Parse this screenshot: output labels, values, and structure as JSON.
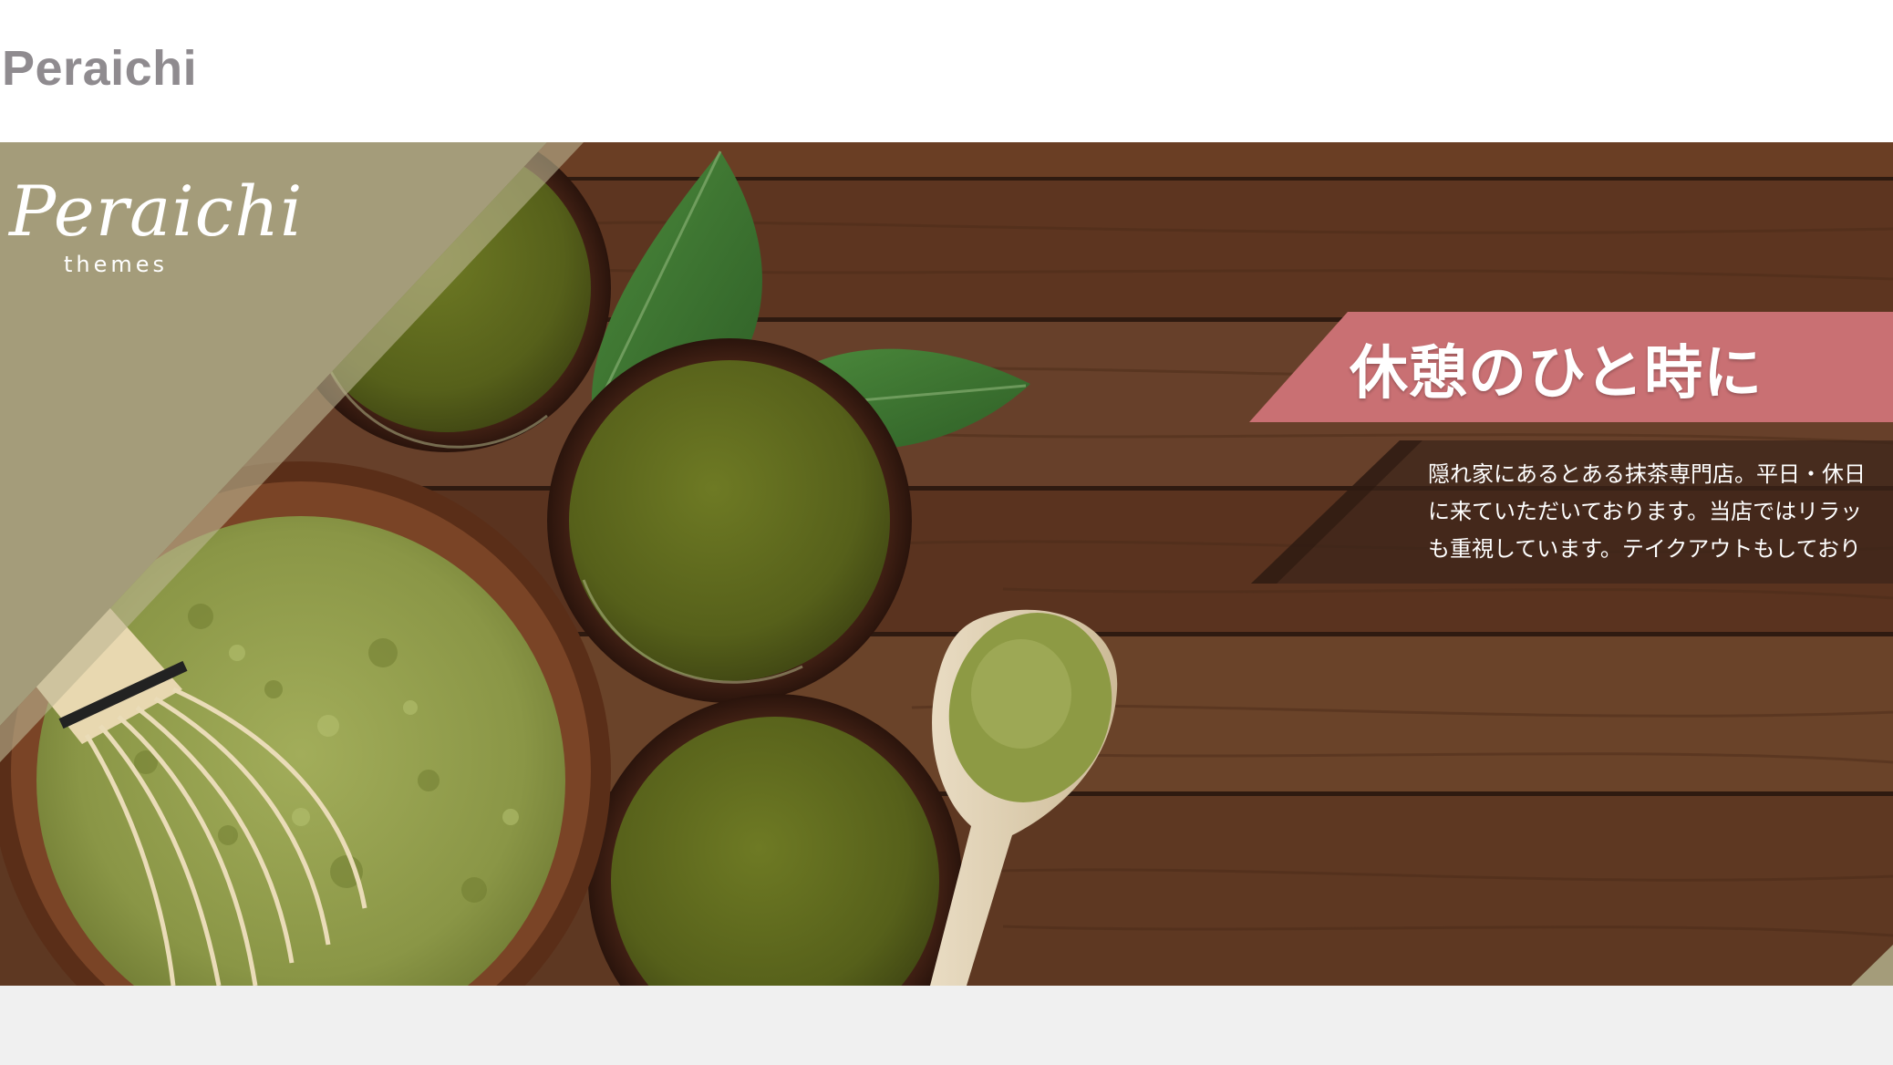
{
  "header": {
    "logo_text": "Peraichi"
  },
  "hero": {
    "brand": {
      "script": "Peraichi",
      "sub": "themes"
    },
    "catch_title": "休憩のひと時に",
    "catch_description": "隠れ家にあるとある抹茶専門店。平日・休日\nに来ていただいております。当店ではリラッ\nも重視しています。テイクアウトもしており",
    "image_subject": "matcha-tea-bowls-on-wood"
  },
  "next_section": {
    "heading": ""
  },
  "colors": {
    "logo_gray": "#8f8b8f",
    "olive_panel": "#a49c7a",
    "rose_band": "#c97073",
    "dark_band": "#3b241a",
    "wood": "#5a3520",
    "section_bg": "#f0f0f0"
  }
}
